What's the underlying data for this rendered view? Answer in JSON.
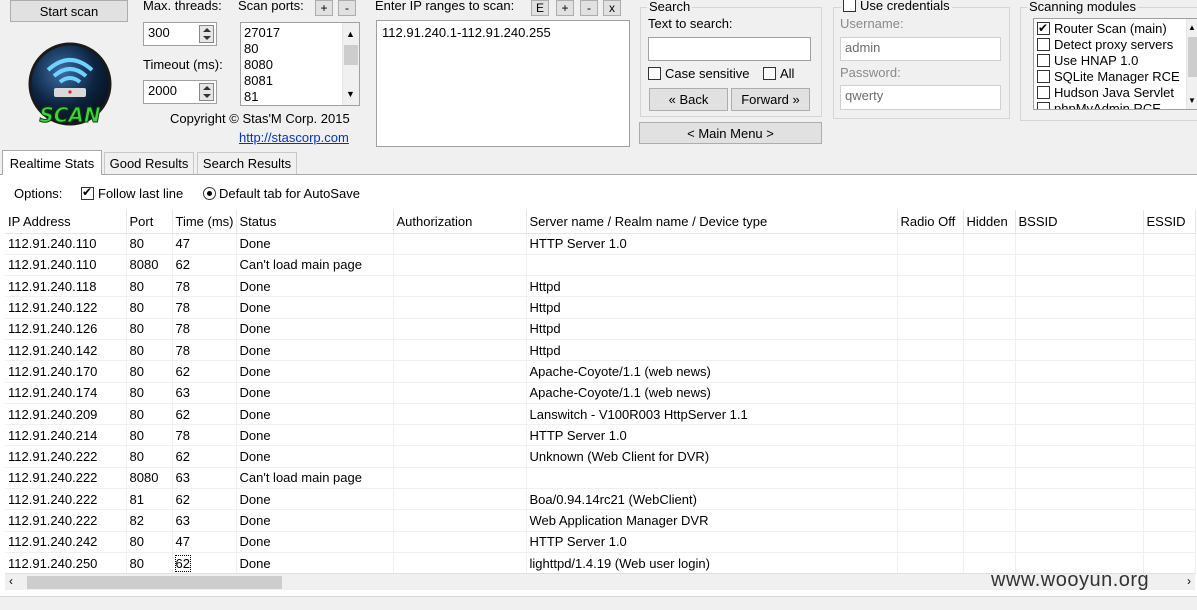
{
  "toolbar": {
    "start_scan": "Start scan",
    "max_threads_label": "Max. threads:",
    "max_threads_value": "300",
    "timeout_label": "Timeout (ms):",
    "timeout_value": "2000",
    "scan_ports_label": "Scan ports:",
    "ports": [
      "27017",
      "80",
      "8080",
      "8081",
      "81"
    ],
    "ip_ranges_label": "Enter IP ranges to scan:",
    "ip_ranges_value": "112.91.240.1-112.91.240.255",
    "ip_btn_e": "E",
    "plus": "+",
    "minus": "-",
    "ip_btn_x": "x",
    "copyright": "Copyright © Stas'M Corp. 2015",
    "link": "http://stascorp.com",
    "logo_text": "SCAN"
  },
  "search": {
    "group_title": "Search",
    "text_label": "Text to search:",
    "text_value": "",
    "case_sensitive": "Case sensitive",
    "all": "All",
    "back": "« Back",
    "forward": "Forward »",
    "main_menu": "< Main Menu >"
  },
  "credentials": {
    "use_label": "Use credentials",
    "username_label": "Username:",
    "username_value": "admin",
    "password_label": "Password:",
    "password_value": "qwerty"
  },
  "modules": {
    "title": "Scanning modules",
    "items": [
      {
        "label": "Router Scan (main)",
        "checked": true
      },
      {
        "label": "Detect proxy servers",
        "checked": false
      },
      {
        "label": "Use HNAP 1.0",
        "checked": false
      },
      {
        "label": "SQLite Manager RCE",
        "checked": false
      },
      {
        "label": "Hudson Java Servlet",
        "checked": false
      },
      {
        "label": "phpMyAdmin RCE",
        "checked": false
      }
    ]
  },
  "tabs": [
    "Realtime Stats",
    "Good Results",
    "Search Results"
  ],
  "options": {
    "label": "Options:",
    "follow_last_line": "Follow last line",
    "default_tab": "Default tab for AutoSave"
  },
  "table": {
    "columns": [
      "IP Address",
      "Port",
      "Time (ms)",
      "Status",
      "Authorization",
      "Server name / Realm name / Device type",
      "Radio Off",
      "Hidden",
      "BSSID",
      "ESSID"
    ],
    "rows": [
      [
        "112.91.240.110",
        "80",
        "47",
        "Done",
        "",
        "HTTP Server 1.0",
        "",
        "",
        "",
        ""
      ],
      [
        "112.91.240.110",
        "8080",
        "62",
        "Can't load main page",
        "",
        "",
        "",
        "",
        "",
        ""
      ],
      [
        "112.91.240.118",
        "80",
        "78",
        "Done",
        "",
        "Httpd",
        "",
        "",
        "",
        ""
      ],
      [
        "112.91.240.122",
        "80",
        "78",
        "Done",
        "",
        "Httpd",
        "",
        "",
        "",
        ""
      ],
      [
        "112.91.240.126",
        "80",
        "78",
        "Done",
        "",
        "Httpd",
        "",
        "",
        "",
        ""
      ],
      [
        "112.91.240.142",
        "80",
        "78",
        "Done",
        "",
        "Httpd",
        "",
        "",
        "",
        ""
      ],
      [
        "112.91.240.170",
        "80",
        "62",
        "Done",
        "",
        "Apache-Coyote/1.1 (web news)",
        "",
        "",
        "",
        ""
      ],
      [
        "112.91.240.174",
        "80",
        "63",
        "Done",
        "",
        "Apache-Coyote/1.1 (web news)",
        "",
        "",
        "",
        ""
      ],
      [
        "112.91.240.209",
        "80",
        "62",
        "Done",
        "",
        "Lanswitch - V100R003 HttpServer 1.1",
        "",
        "",
        "",
        ""
      ],
      [
        "112.91.240.214",
        "80",
        "78",
        "Done",
        "",
        "HTTP Server 1.0",
        "",
        "",
        "",
        ""
      ],
      [
        "112.91.240.222",
        "80",
        "62",
        "Done",
        "",
        "Unknown (Web Client for DVR)",
        "",
        "",
        "",
        ""
      ],
      [
        "112.91.240.222",
        "8080",
        "63",
        "Can't load main page",
        "",
        "",
        "",
        "",
        "",
        ""
      ],
      [
        "112.91.240.222",
        "81",
        "62",
        "Done",
        "",
        "Boa/0.94.14rc21 (WebClient)",
        "",
        "",
        "",
        ""
      ],
      [
        "112.91.240.222",
        "82",
        "63",
        "Done",
        "",
        "Web Application Manager DVR",
        "",
        "",
        "",
        ""
      ],
      [
        "112.91.240.242",
        "80",
        "47",
        "Done",
        "",
        "HTTP Server 1.0",
        "",
        "",
        "",
        ""
      ],
      [
        "112.91.240.250",
        "80",
        "62",
        "Done",
        "",
        "lighttpd/1.4.19 (Web user login)",
        "",
        "",
        "",
        ""
      ]
    ]
  },
  "watermark": "www.wooyun.org"
}
